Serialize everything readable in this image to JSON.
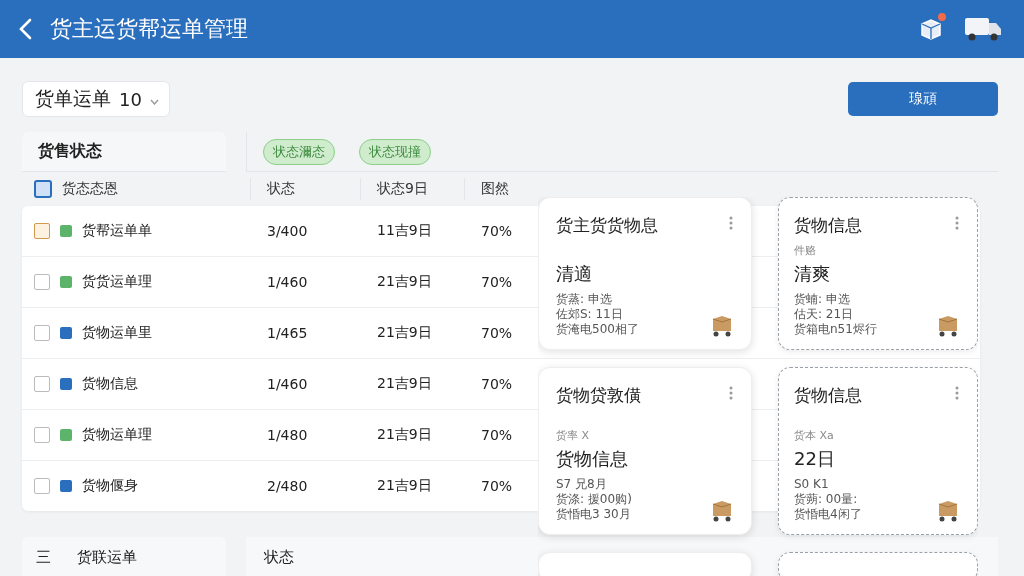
{
  "header": {
    "title": "货主运货帮运单管理",
    "notification_dot": true
  },
  "toolbar": {
    "dropdown": {
      "label": "货单运单",
      "value": "10"
    },
    "button": "瑔頑"
  },
  "filter": {
    "label": "货售状态",
    "chips": [
      "状态濔态",
      "状态现撞"
    ]
  },
  "table": {
    "select_all_highlighted": true,
    "columns": [
      "货态态恩",
      "状态",
      "状态9日",
      "图然"
    ],
    "rows": [
      {
        "name": "货帮运单单",
        "color": "#5cb46a",
        "selected": true,
        "qty": "3/400",
        "date": "11吉9日",
        "pct": "70%"
      },
      {
        "name": "货货运单理",
        "color": "#5cb46a",
        "selected": false,
        "qty": "1/460",
        "date": "21吉9日",
        "pct": "70%"
      },
      {
        "name": "货物运单里",
        "color": "#2a6fbe",
        "selected": false,
        "qty": "1/465",
        "date": "21吉9日",
        "pct": "70%"
      },
      {
        "name": "货物信息",
        "color": "#2a6fbe",
        "selected": false,
        "qty": "1/460",
        "date": "21吉9日",
        "pct": "70%"
      },
      {
        "name": "货物运单理",
        "color": "#5cb46a",
        "selected": false,
        "qty": "1/480",
        "date": "21吉9日",
        "pct": "70%"
      },
      {
        "name": "货物偃身",
        "color": "#2a6fbe",
        "selected": false,
        "qty": "2/480",
        "date": "21吉9日",
        "pct": "70%"
      }
    ]
  },
  "footer_row": {
    "menu_glyph": "三",
    "label": "货联运单",
    "status": "状态"
  },
  "cards": [
    {
      "kind": "full",
      "dashed": false,
      "title": "货主货货物息",
      "lines": [
        {
          "kind": "big",
          "text": "清適"
        },
        {
          "kind": "small",
          "text": "货蒸: 申选"
        },
        {
          "kind": "small",
          "text": "佐郊S: 11日"
        },
        {
          "kind": "small",
          "text": "货淹电500相了"
        }
      ]
    },
    {
      "kind": "full",
      "dashed": true,
      "title": "货物信息",
      "lines": [
        {
          "kind": "faint",
          "text": "件赂"
        },
        {
          "kind": "big",
          "text": "清爽"
        },
        {
          "kind": "small",
          "text": "货蝻: 申选"
        },
        {
          "kind": "small",
          "text": "估天: 21日"
        },
        {
          "kind": "small",
          "text": "货箱电n51烬行"
        }
      ]
    },
    {
      "kind": "full",
      "dashed": false,
      "title": "货物贷敦僙",
      "lines": [
        {
          "kind": "faint",
          "text": "货率 X"
        },
        {
          "kind": "big",
          "text": "货物信息"
        },
        {
          "kind": "small",
          "text": "S7 兄8月"
        },
        {
          "kind": "small",
          "text": "货涤: 援00购)"
        },
        {
          "kind": "small",
          "text": "货惛电3 30月"
        }
      ]
    },
    {
      "kind": "full",
      "dashed": true,
      "title": "货物信息",
      "lines": [
        {
          "kind": "faint",
          "text": "货本 Xa"
        },
        {
          "kind": "big",
          "text": "22日"
        },
        {
          "kind": "small",
          "text": "S0 K1"
        },
        {
          "kind": "small",
          "text": "货蒴: 00量:"
        },
        {
          "kind": "small",
          "text": "货惛电4闲了"
        }
      ]
    },
    {
      "kind": "stub",
      "dashed": false
    },
    {
      "kind": "stub",
      "dashed": true
    }
  ]
}
